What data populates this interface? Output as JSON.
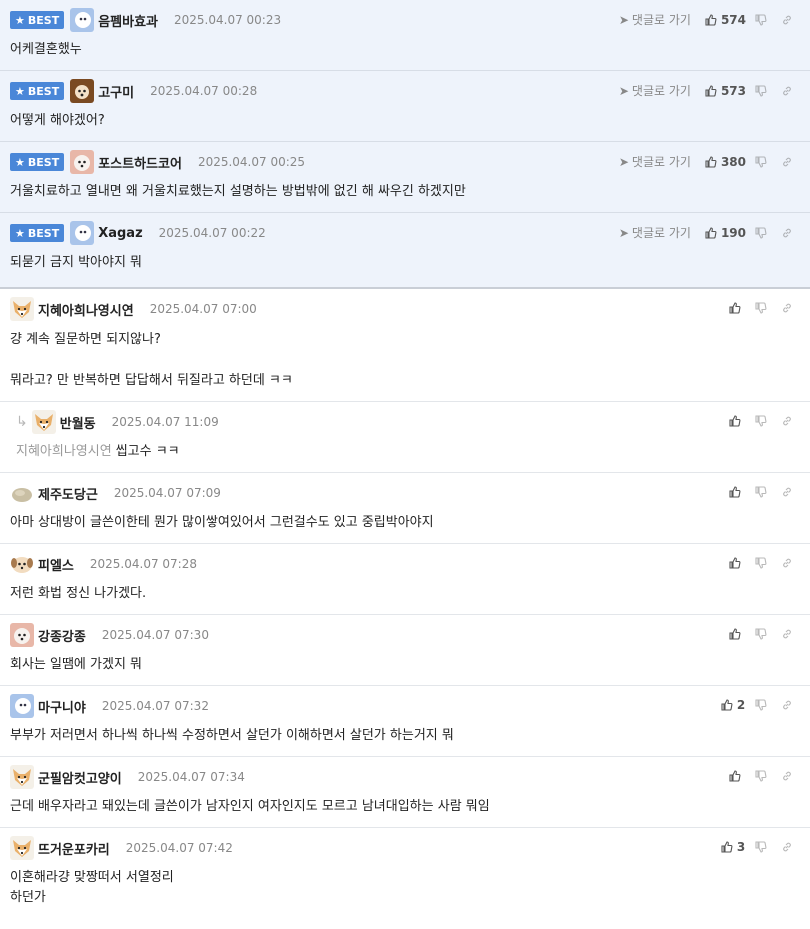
{
  "labels": {
    "best": "BEST",
    "goto": "댓글로 가기"
  },
  "comments": [
    {
      "nick": "음펨바효과",
      "date": "2025.04.07 00:23",
      "likes": "574",
      "lines": [
        "어케결혼했누"
      ],
      "avatar": "blue"
    },
    {
      "nick": "고구미",
      "date": "2025.04.07 00:28",
      "likes": "573",
      "lines": [
        "어떻게 해야겠어?"
      ],
      "avatar": "dog"
    },
    {
      "nick": "포스트하드코어",
      "date": "2025.04.07 00:25",
      "likes": "380",
      "lines": [
        "거울치료하고 열내면 왜 거울치료했는지 설명하는 방법밖에 없긴 해 싸우긴 하겠지만"
      ],
      "avatar": "pink"
    },
    {
      "nick": "Xagaz",
      "date": "2025.04.07 00:22",
      "likes": "190",
      "lines": [
        "되묻기 금지 박아야지 뭐"
      ],
      "avatar": "blue"
    },
    {
      "nick": "지혜아희나영시연",
      "date": "2025.04.07 07:00",
      "likes": "",
      "lines": [
        "걍 계속 질문하면 되지않나?",
        "",
        "뭐라고? 만 반복하면 답답해서 뒤질라고 하던데 ㅋㅋ"
      ],
      "avatar": "fox"
    },
    {
      "nick": "반월동",
      "date": "2025.04.07 11:09",
      "likes": "",
      "mention": "지혜아희나영시연",
      "lines": [
        "씹고수 ㅋㅋ"
      ],
      "avatar": "fox"
    },
    {
      "nick": "제주도당근",
      "date": "2025.04.07 07:09",
      "likes": "",
      "lines": [
        "아마 상대방이 글쓴이한테 뭔가 많이쌓여있어서 그런걸수도 있고 중립박아야지"
      ],
      "avatar": "stone"
    },
    {
      "nick": "피엘스",
      "date": "2025.04.07 07:28",
      "likes": "",
      "lines": [
        "저런 화법 정신 나가겠다."
      ],
      "avatar": "pup"
    },
    {
      "nick": "강종강종",
      "date": "2025.04.07 07:30",
      "likes": "",
      "lines": [
        "회사는 일땜에 가겠지 뭐"
      ],
      "avatar": "pink"
    },
    {
      "nick": "마구니야",
      "date": "2025.04.07 07:32",
      "likes": "2",
      "lines": [
        "부부가 저러면서 하나씩 하나씩 수정하면서 살던가 이해하면서 살던가 하는거지 뭐"
      ],
      "avatar": "blue"
    },
    {
      "nick": "군필암컷고양이",
      "date": "2025.04.07 07:34",
      "likes": "",
      "lines": [
        "근데 배우자라고 돼있는데 글쓴이가 남자인지 여자인지도 모르고 남녀대입하는 사람 뭐임"
      ],
      "avatar": "fox"
    },
    {
      "nick": "뜨거운포카리",
      "date": "2025.04.07 07:42",
      "likes": "3",
      "lines": [
        "이혼해라걍 맞짱떠서 서열정리",
        "하던가"
      ],
      "avatar": "fox"
    }
  ]
}
